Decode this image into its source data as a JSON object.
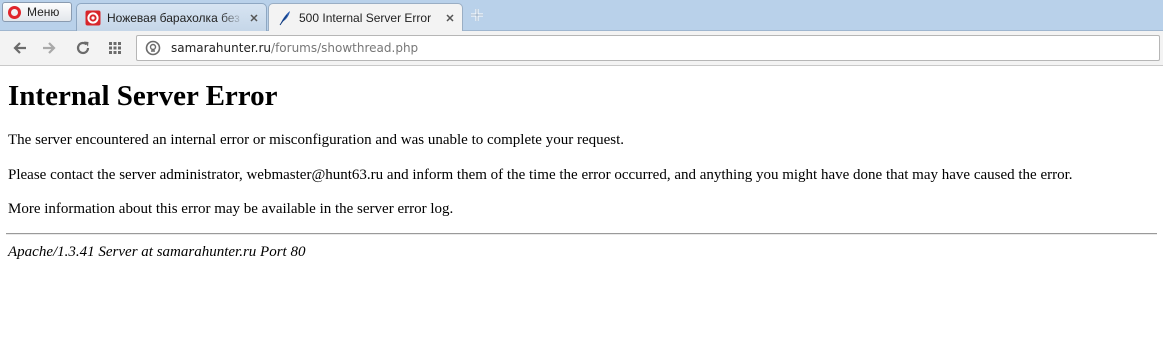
{
  "browser": {
    "menu_label": "Меню",
    "tabs": [
      {
        "title": "Ножевая барахолка без п",
        "favicon": "samarahunter-red-favicon",
        "active": false
      },
      {
        "title": "500 Internal Server Error",
        "favicon": "feather-favicon",
        "active": true
      }
    ],
    "toolbar": {
      "url_host": "samarahunter.ru",
      "url_path": "/forums/showthread.php"
    }
  },
  "page": {
    "heading": "Internal Server Error",
    "paragraphs": [
      "The server encountered an internal error or misconfiguration and was unable to complete your request.",
      "Please contact the server administrator, webmaster@hunt63.ru and inform them of the time the error occurred, and anything you might have done that may have caused the error.",
      "More information about this error may be available in the server error log."
    ],
    "footer": "Apache/1.3.41 Server at samarahunter.ru Port 80"
  },
  "colors": {
    "tabstrip": "#b9d1ea",
    "toolbar": "#f3f3f3",
    "opera_red": "#e0242b"
  }
}
